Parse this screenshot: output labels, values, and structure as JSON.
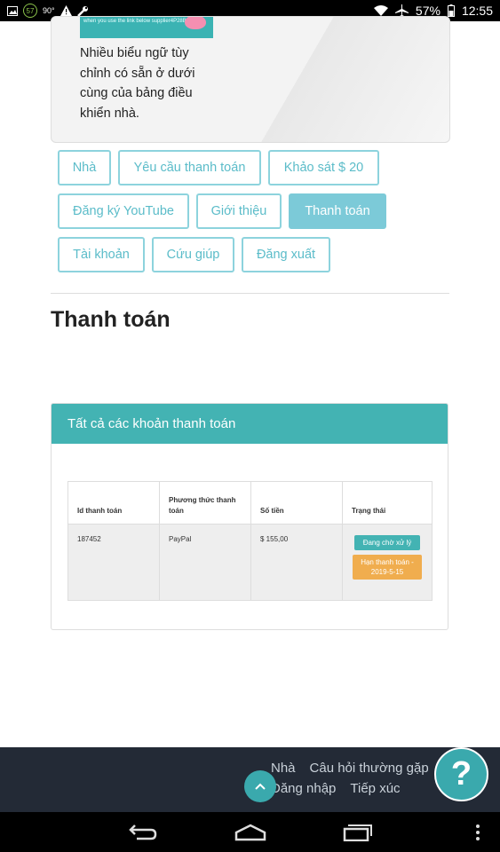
{
  "status_bar": {
    "badge": "57",
    "temp": "90°",
    "battery": "57%",
    "time": "12:55"
  },
  "banner": {
    "image_text": "when you use the link below supplier4P28BiD2",
    "text": "Nhiều biểu ngữ tùy chỉnh có sẵn ở dưới cùng của bảng điều khiển nhà."
  },
  "nav": {
    "items": [
      {
        "label": "Nhà"
      },
      {
        "label": "Yêu cầu thanh toán"
      },
      {
        "label": "Khảo sát $ 20"
      },
      {
        "label": "Đăng ký YouTube"
      },
      {
        "label": "Giới thiệu"
      },
      {
        "label": "Thanh toán"
      },
      {
        "label": "Tài khoản"
      },
      {
        "label": "Cứu giúp"
      },
      {
        "label": "Đăng xuất"
      }
    ],
    "active": "Thanh toán"
  },
  "page": {
    "title": "Thanh toán"
  },
  "payments_panel": {
    "header": "Tất cả các khoản thanh toán",
    "columns": [
      "Id thanh toán",
      "Phương thức thanh toán",
      "Số tiền",
      "Trạng thái"
    ],
    "rows": [
      {
        "id": "187452",
        "method": "PayPal",
        "amount": "$ 155,00",
        "status": "Đang chờ xử lý",
        "due": "Hạn thanh toán - 2019-5-15"
      }
    ]
  },
  "footer": {
    "links": [
      "Nhà",
      "Câu hỏi thường gặp",
      "Đăng nhập",
      "Tiếp xúc"
    ],
    "help_symbol": "?",
    "scroll_top_symbol": "^"
  },
  "colors": {
    "accent": "#43b3b3",
    "nav_border": "#8dd3dd",
    "nav_active": "#7ccad8",
    "warning": "#f0ad4e",
    "footer_bg": "#232a36"
  }
}
